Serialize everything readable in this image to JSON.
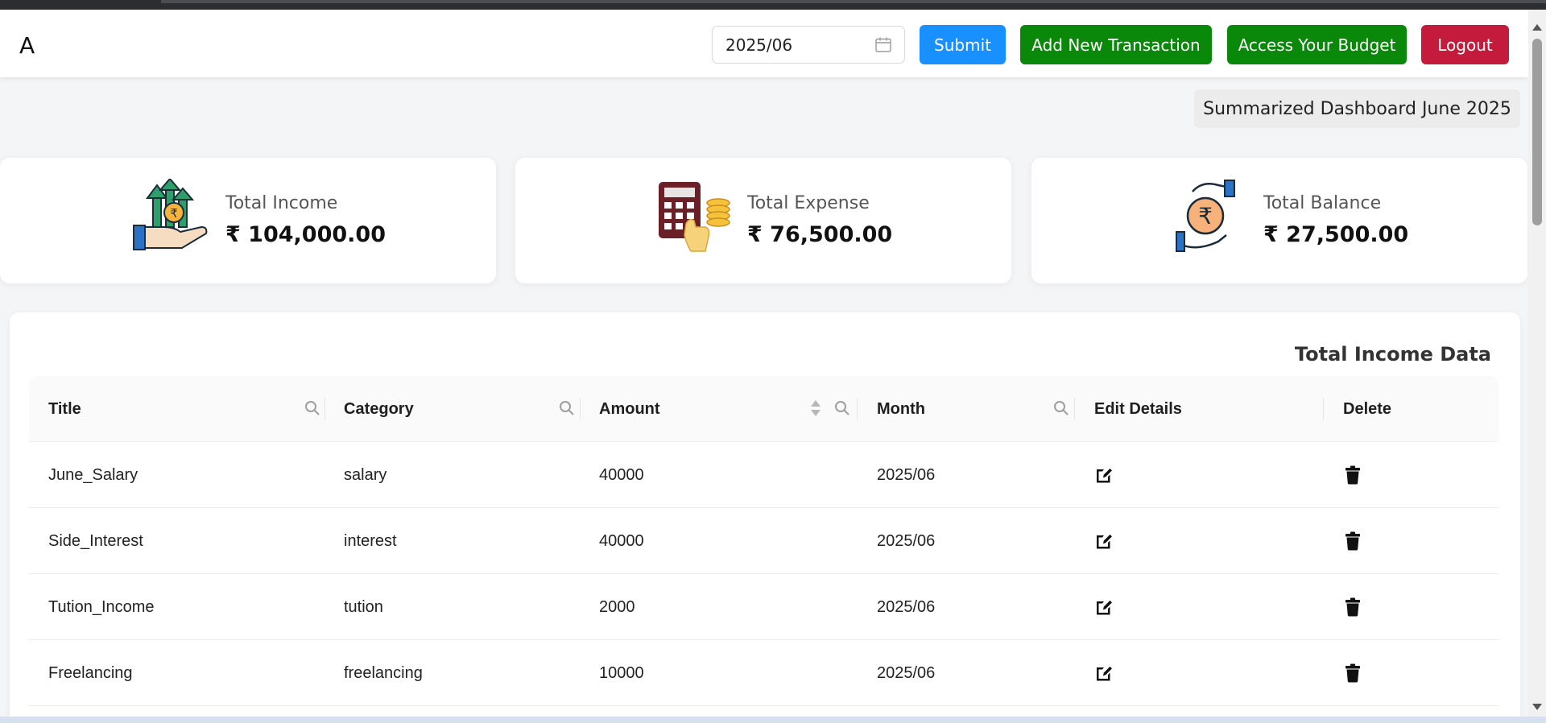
{
  "header": {
    "logo": "A",
    "date_value": "2025/06",
    "submit_label": "Submit",
    "add_transaction_label": "Add New Transaction",
    "budget_label": "Access Your Budget",
    "logout_label": "Logout"
  },
  "summary_badge": "Summarized Dashboard June 2025",
  "cards": {
    "income": {
      "label": "Total Income",
      "value": "₹ 104,000.00",
      "icon": "income-hand-icon"
    },
    "expense": {
      "label": "Total Expense",
      "value": "₹ 76,500.00",
      "icon": "calculator-coins-icon"
    },
    "balance": {
      "label": "Total Balance",
      "value": "₹ 27,500.00",
      "icon": "rupee-hands-icon"
    }
  },
  "table": {
    "title": "Total Income Data",
    "columns": [
      "Title",
      "Category",
      "Amount",
      "Month",
      "Edit Details",
      "Delete"
    ],
    "rows": [
      {
        "title": "June_Salary",
        "category": "salary",
        "amount": "40000",
        "month": "2025/06"
      },
      {
        "title": "Side_Interest",
        "category": "interest",
        "amount": "40000",
        "month": "2025/06"
      },
      {
        "title": "Tution_Income",
        "category": "tution",
        "amount": "2000",
        "month": "2025/06"
      },
      {
        "title": "Freelancing",
        "category": "freelancing",
        "amount": "10000",
        "month": "2025/06"
      }
    ]
  },
  "colors": {
    "submit": "#1890ff",
    "add_transaction": "#098809",
    "budget": "#098809",
    "logout": "#c41a3b"
  }
}
